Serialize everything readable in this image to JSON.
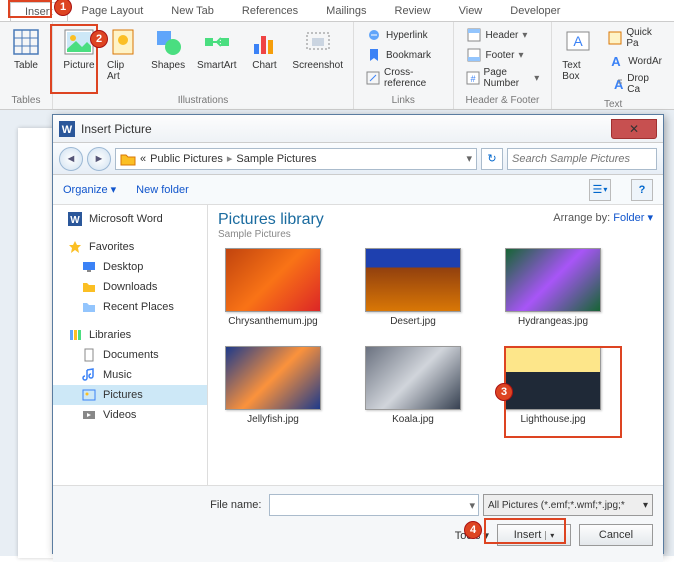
{
  "ribbon": {
    "tabs": [
      "Insert",
      "Page Layout",
      "New Tab",
      "References",
      "Mailings",
      "Review",
      "View",
      "Developer"
    ],
    "active_tab": "Insert",
    "groups": {
      "tables": {
        "label": "Tables",
        "table": "Table"
      },
      "illustrations": {
        "label": "Illustrations",
        "picture": "Picture",
        "clipart": "Clip Art",
        "shapes": "Shapes",
        "smartart": "SmartArt",
        "chart": "Chart",
        "screenshot": "Screenshot"
      },
      "links": {
        "label": "Links",
        "hyperlink": "Hyperlink",
        "bookmark": "Bookmark",
        "crossref": "Cross-reference"
      },
      "headerfooter": {
        "label": "Header & Footer",
        "header": "Header",
        "footer": "Footer",
        "pagenum": "Page Number"
      },
      "text": {
        "label": "Text",
        "textbox": "Text Box",
        "quick": "Quick Pa",
        "wordart": "WordAr",
        "dropcap": "Drop Ca"
      }
    }
  },
  "dialog": {
    "title": "Insert Picture",
    "breadcrumb": {
      "prefix": "«",
      "part1": "Public Pictures",
      "part2": "Sample Pictures"
    },
    "search_placeholder": "Search Sample Pictures",
    "toolbar": {
      "organize": "Organize",
      "newfolder": "New folder"
    },
    "content": {
      "title": "Pictures library",
      "subtitle": "Sample Pictures",
      "arrange_label": "Arrange by:",
      "arrange_value": "Folder"
    },
    "sidebar": {
      "word": "Microsoft Word",
      "favorites": "Favorites",
      "desktop": "Desktop",
      "downloads": "Downloads",
      "recent": "Recent Places",
      "libraries": "Libraries",
      "documents": "Documents",
      "music": "Music",
      "pictures": "Pictures",
      "videos": "Videos"
    },
    "thumbs": [
      {
        "name": "Chrysanthemum.jpg",
        "bg": "linear-gradient(135deg,#c1440e,#f97316,#dc2626)"
      },
      {
        "name": "Desert.jpg",
        "bg": "linear-gradient(180deg,#1e40af 30%,#92400e 30%,#d97706)"
      },
      {
        "name": "Hydrangeas.jpg",
        "bg": "linear-gradient(135deg,#166534,#a855f7,#166534)"
      },
      {
        "name": "Jellyfish.jpg",
        "bg": "linear-gradient(135deg,#1e3a8a,#fb923c,#1e3a8a)"
      },
      {
        "name": "Koala.jpg",
        "bg": "linear-gradient(135deg,#6b7280,#d1d5db,#374151)"
      },
      {
        "name": "Lighthouse.jpg",
        "bg": "linear-gradient(180deg,#fde68a 40%,#1f2937 40%)"
      }
    ],
    "footer": {
      "filename_label": "File name:",
      "filename_value": "",
      "filter": "All Pictures (*.emf;*.wmf;*.jpg;*",
      "tools": "Tools",
      "insert": "Insert",
      "cancel": "Cancel"
    }
  },
  "markers": {
    "m1": "1",
    "m2": "2",
    "m3": "3",
    "m4": "4"
  }
}
